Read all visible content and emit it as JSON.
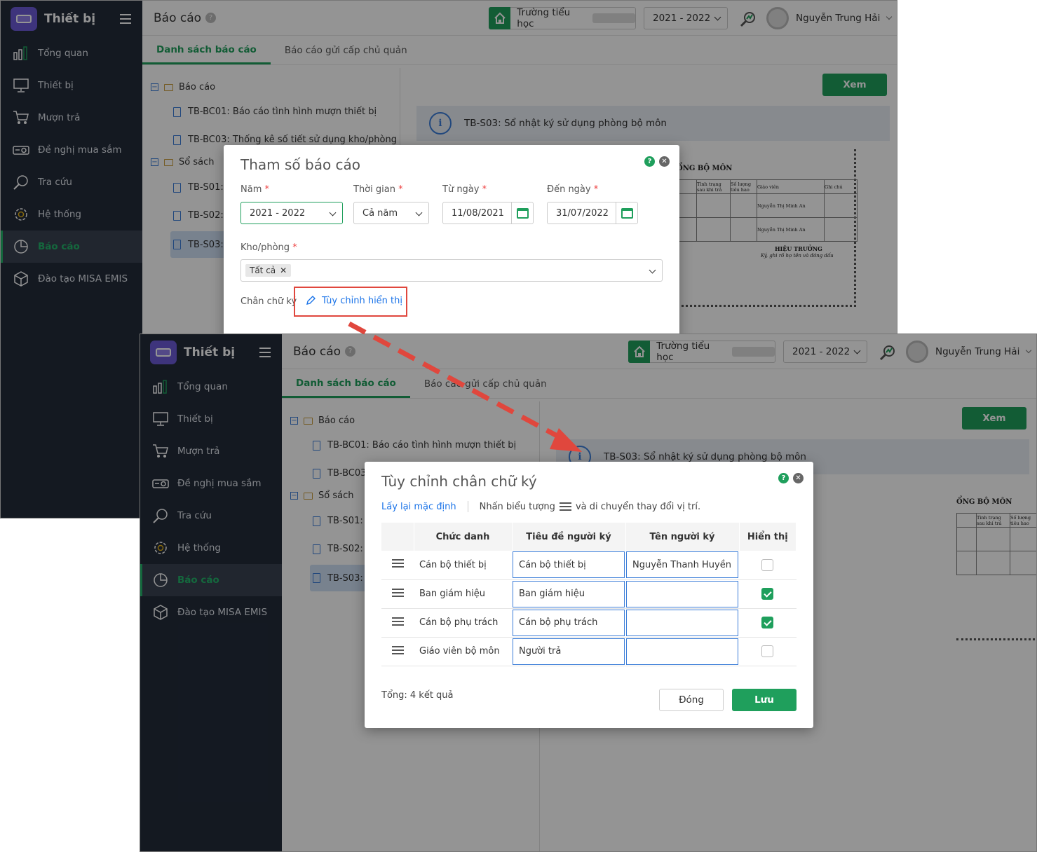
{
  "app": {
    "name": "Thiết bị"
  },
  "sidebar": {
    "items": [
      {
        "label": "Tổng quan",
        "icon": "bar-chart-icon"
      },
      {
        "label": "Thiết bị",
        "icon": "monitor-icon"
      },
      {
        "label": "Mượn trả",
        "icon": "cart-icon"
      },
      {
        "label": "Đề nghị mua sắm",
        "icon": "projector-icon"
      },
      {
        "label": "Tra cứu",
        "icon": "search-icon"
      },
      {
        "label": "Hệ thống",
        "icon": "gear-icon"
      },
      {
        "label": "Báo cáo",
        "icon": "pie-chart-icon",
        "active": true
      },
      {
        "label": "Đào tạo MISA EMIS",
        "icon": "cube-icon"
      }
    ]
  },
  "header": {
    "title": "Báo cáo",
    "help": "?",
    "school": "Trường tiểu học",
    "year": "2021 - 2022",
    "user": "Nguyễn Trung Hải"
  },
  "tabs": [
    "Danh sách báo cáo",
    "Báo cáo gửi cấp chủ quản"
  ],
  "tree": {
    "group1": "Báo cáo",
    "item1": "TB-BC01: Báo cáo tình hình mượn thiết bị",
    "item2": "TB-BC03: Thống kê số tiết sử dụng kho/phòng",
    "item2_short": "TB-BC03:",
    "group2": "Sổ sách",
    "s1": "TB-S01:",
    "s2": "TB-S02:",
    "s3": "TB-S03:"
  },
  "view_button": "Xem",
  "info_text": "TB-S03: Sổ nhật ký sử dụng phòng bộ môn",
  "preview": {
    "heading": "ỔNG BỘ MÔN",
    "col1": "Tình trạng sau khi trả",
    "col2": "Số lượng tiêu hao",
    "col3": "Giáo viên",
    "col4": "Ghi chú",
    "teacher": "Nguyễn Thị Minh An",
    "sig_title": "HIỆU TRƯỞNG",
    "sig_note": "Ký, ghi rõ họ tên và đóng dấu"
  },
  "params_dialog": {
    "title": "Tham số báo cáo",
    "year_label": "Năm",
    "year": "2021 - 2022",
    "period_label": "Thời gian",
    "period": "Cả năm",
    "from_label": "Từ ngày",
    "from": "11/08/2021",
    "to_label": "Đến ngày",
    "to": "31/07/2022",
    "room_label": "Kho/phòng",
    "room_chip": "Tất cả",
    "signature_label": "Chân chữ ký",
    "customize_link": "Tùy chỉnh hiển thị",
    "required": "*"
  },
  "sig_dialog": {
    "title": "Tùy chỉnh chân chữ ký",
    "reset_link": "Lấy lại mặc định",
    "hint_before": "Nhấn biểu tượng",
    "hint_after": "và di chuyển thay đổi vị trí.",
    "columns": [
      "Chức danh",
      "Tiêu đề người ký",
      "Tên người ký",
      "Hiển thị"
    ],
    "rows": [
      {
        "role": "Cán bộ thiết bị",
        "title": "Cán bộ thiết bị",
        "name": "Nguyễn Thanh Huyền",
        "show": false
      },
      {
        "role": "Ban giám hiệu",
        "title": "Ban giám hiệu",
        "name": "",
        "show": true
      },
      {
        "role": "Cán bộ phụ trách",
        "title": "Cán bộ phụ trách",
        "name": "",
        "show": true
      },
      {
        "role": "Giáo viên bộ môn",
        "title": "Người trả",
        "name": "",
        "show": false
      }
    ],
    "total": "Tổng: 4 kết quả",
    "close": "Đóng",
    "save": "Lưu"
  },
  "colors": {
    "accent": "#1f9f5c",
    "sidebar": "#232b3a",
    "highlight": "#e0473d"
  }
}
